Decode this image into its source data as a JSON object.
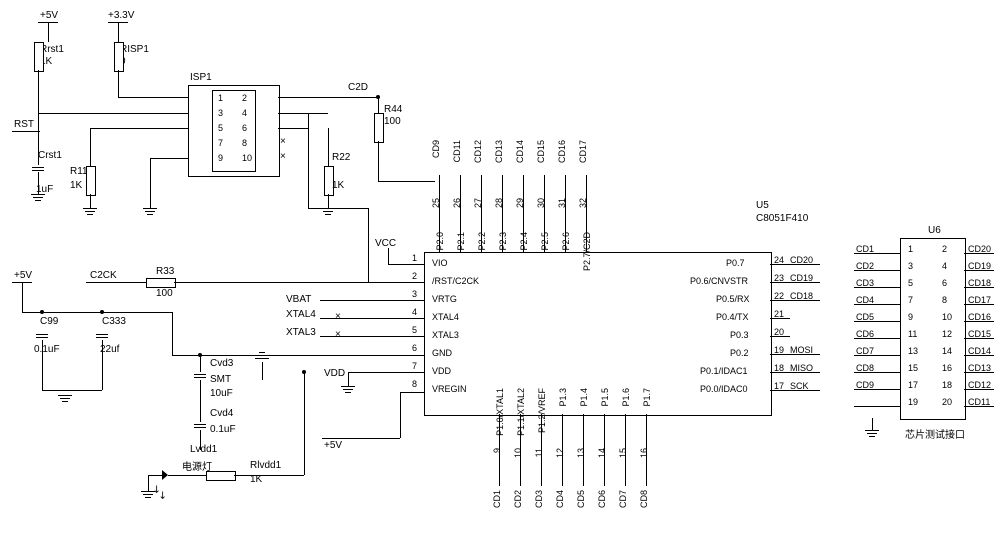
{
  "power": {
    "v5": "+5V",
    "v33": "+3.3V",
    "rst_label": "RST",
    "vcc": "VCC",
    "vdd": "VDD",
    "v5_bottom": "+5V"
  },
  "components": {
    "rrst1": {
      "name": "Rrst1",
      "value": "1K"
    },
    "risp1": {
      "name": "RISP1",
      "value": "0"
    },
    "crst1": {
      "name": "Crst1",
      "value": "1uF"
    },
    "r11": {
      "name": "R11",
      "value": "1K"
    },
    "r22": {
      "name": "R22",
      "value": "1K"
    },
    "r33": {
      "name": "R33",
      "value": "100"
    },
    "r44": {
      "name": "R44",
      "value": "100"
    },
    "c99": {
      "name": "C99",
      "value": "0.1uF"
    },
    "c333": {
      "name": "C333",
      "value": "22uf"
    },
    "cvd3": {
      "name": "Cvd3",
      "value": "10uF"
    },
    "cvd4": {
      "name": "Cvd4",
      "value": "0.1uF"
    },
    "lvdd1": {
      "name": "Lvdd1",
      "caption": "电源灯"
    },
    "rlvdd1": {
      "name": "Rlvdd1",
      "value": "1K"
    },
    "smt": "SMT",
    "isp1": "ISP1",
    "c2d": "C2D",
    "c2ck": "C2CK",
    "vbat": "VBAT",
    "xtal4": "XTAL4",
    "xtal3": "XTAL3"
  },
  "u5": {
    "ref": "U5",
    "part": "C8051F410",
    "left": [
      "VIO",
      "/RST/C2CK",
      "VRTG",
      "XTAL4",
      "XTAL3",
      "GND",
      "VDD",
      "VREGIN"
    ],
    "right": [
      "P0.7",
      "P0.6/CNVSTR",
      "P0.5/RX",
      "P0.4/TX",
      "P0.3",
      "P0.2",
      "P0.1/IDAC1",
      "P0.0/IDAC0"
    ],
    "top": [
      "P2.7/C2D",
      "P2.6",
      "P2.5",
      "P2.4",
      "P2.3",
      "P2.2",
      "P2.1",
      "P2.0"
    ],
    "bottom": [
      "P1.0/XTAL1",
      "P1.1/XTAL2",
      "P1.2/VREF",
      "P1.3",
      "P1.4",
      "P1.5",
      "P1.6",
      "P1.7"
    ],
    "left_pins": [
      "1",
      "2",
      "3",
      "4",
      "5",
      "6",
      "7",
      "8"
    ],
    "right_pins": [
      "24",
      "23",
      "22",
      "21",
      "20",
      "19",
      "18",
      "17"
    ],
    "right_nets": [
      "CD20",
      "CD19",
      "CD18",
      "",
      "",
      "MOSI",
      "MISO",
      "SCK"
    ],
    "top_pins": [
      "32",
      "31",
      "30",
      "29",
      "28",
      "27",
      "26",
      "25"
    ],
    "top_nets": [
      "CD17",
      "CD16",
      "CD15",
      "CD14",
      "CD13",
      "CD12",
      "CD11",
      "CD9"
    ],
    "bottom_pins": [
      "9",
      "10",
      "11",
      "12",
      "13",
      "14",
      "15",
      "16"
    ],
    "bottom_nets": [
      "CD1",
      "CD2",
      "CD3",
      "CD4",
      "CD5",
      "CD6",
      "CD7",
      "CD8"
    ]
  },
  "u6": {
    "ref": "U6",
    "caption": "芯片测试接口",
    "left_nets": [
      "CD1",
      "CD2",
      "CD3",
      "CD4",
      "CD5",
      "CD6",
      "CD7",
      "CD8",
      "CD9",
      ""
    ],
    "right_nets": [
      "CD20",
      "CD19",
      "CD18",
      "CD17",
      "CD16",
      "CD15",
      "CD14",
      "CD13",
      "CD12",
      "CD11"
    ],
    "left_pins": [
      "1",
      "3",
      "5",
      "7",
      "9",
      "11",
      "13",
      "15",
      "17",
      "19"
    ],
    "right_pins": [
      "2",
      "4",
      "6",
      "8",
      "10",
      "12",
      "14",
      "16",
      "18",
      "20"
    ]
  },
  "isp_pins": {
    "left": [
      "1",
      "3",
      "5",
      "7",
      "9"
    ],
    "right": [
      "2",
      "4",
      "6",
      "8",
      "10"
    ]
  }
}
